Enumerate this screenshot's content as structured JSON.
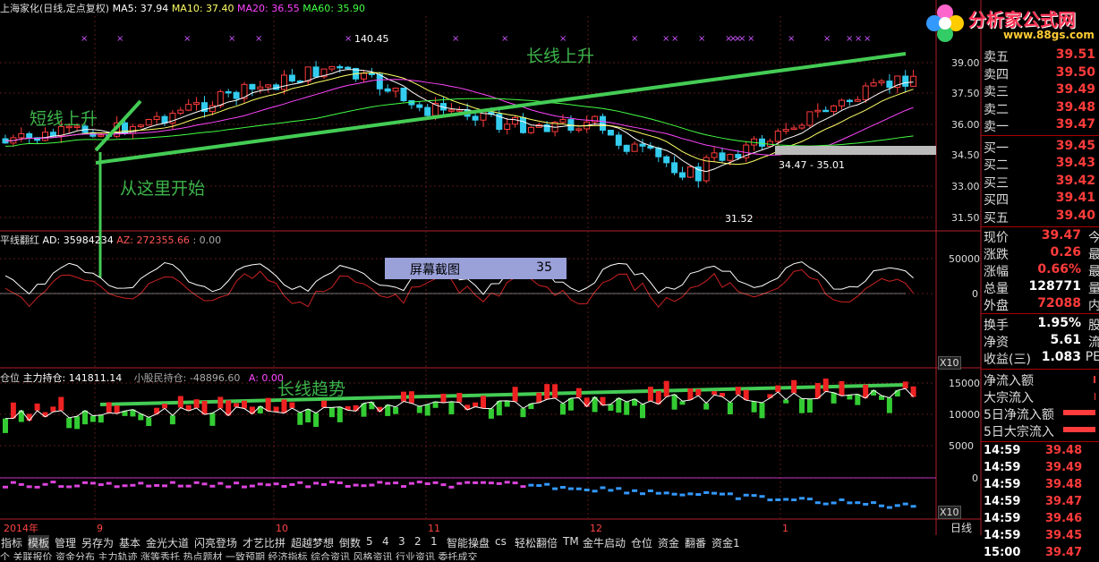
{
  "header": {
    "title": "上海家化(日线,定点复权)",
    "ma5": "MA5: 37.94",
    "ma10": "MA10: 37.40",
    "ma20": "MA20: 36.55",
    "ma60": "MA60: 35.90"
  },
  "indicator1": {
    "name": "平线翻红",
    "ad": "AD: 35984234",
    "az": "AZ: 272355.66",
    "extra": ": 0.00",
    "axis": [
      "50000",
      "0"
    ],
    "unit": "X10"
  },
  "indicator2": {
    "name": "仓位",
    "main": "主力持仓: 141811.14",
    "small": "小股民持仓: -48896.60",
    "a": "A: 0.00",
    "axis": [
      "15000",
      "10000",
      "5000",
      "0"
    ],
    "unit": "X10"
  },
  "price_axis": [
    "39.00",
    "37.50",
    "36.00",
    "34.50",
    "33.00",
    "31.50"
  ],
  "labels": {
    "high": "140.45",
    "low": "31.52",
    "range": "34.47 - 35.01"
  },
  "annotations": {
    "short_up": "短线上升",
    "start_here": "从这里开始",
    "long_up": "长线上升",
    "long_trend": "长线趋势"
  },
  "screenshot_box": {
    "label": "屏幕截图",
    "count": "35"
  },
  "time_axis": [
    "2014年",
    "9",
    "10",
    "11",
    "12",
    "1"
  ],
  "period": "日线",
  "logo": {
    "brand": "分析家公式网",
    "url": "www.88gs.com"
  },
  "order_book": [
    {
      "label": "卖五",
      "value": "39.51",
      "color": "#ff3b3b"
    },
    {
      "label": "卖四",
      "value": "39.50",
      "color": "#ff3b3b"
    },
    {
      "label": "卖三",
      "value": "39.49",
      "color": "#ff3b3b"
    },
    {
      "label": "卖二",
      "value": "39.48",
      "color": "#ff3b3b"
    },
    {
      "label": "卖一",
      "value": "39.47",
      "color": "#ff3b3b"
    },
    {
      "label": "买一",
      "value": "39.45",
      "color": "#ff3b3b"
    },
    {
      "label": "买二",
      "value": "39.43",
      "color": "#ff3b3b"
    },
    {
      "label": "买三",
      "value": "39.42",
      "color": "#ff3b3b"
    },
    {
      "label": "买四",
      "value": "39.41",
      "color": "#ff3b3b"
    },
    {
      "label": "买五",
      "value": "39.40",
      "color": "#ff3b3b"
    }
  ],
  "quote": [
    {
      "label": "现价",
      "value": "39.47",
      "extra": "今",
      "color": "#ff3b3b"
    },
    {
      "label": "涨跌",
      "value": "0.26",
      "extra": "最",
      "color": "#ff3b3b"
    },
    {
      "label": "涨幅",
      "value": "0.66%",
      "extra": "最",
      "color": "#ff3b3b"
    },
    {
      "label": "总量",
      "value": "128771",
      "extra": "量",
      "color": "#ffffff"
    },
    {
      "label": "外盘",
      "value": "72088",
      "extra": "内",
      "color": "#ff3b3b"
    },
    {
      "label": "换手",
      "value": "1.95%",
      "extra": "股",
      "color": "#ffffff"
    },
    {
      "label": "净资",
      "value": "5.61",
      "extra": "流",
      "color": "#ffffff"
    },
    {
      "label": "收益(三)",
      "value": "1.083",
      "extra": "PE",
      "color": "#ffffff"
    }
  ],
  "flows": [
    {
      "label": "净流入额"
    },
    {
      "label": "大宗流入"
    },
    {
      "label": "5日净流入额"
    },
    {
      "label": "5日大宗流入"
    }
  ],
  "ticks": [
    {
      "time": "14:59",
      "price": "39.48"
    },
    {
      "time": "14:59",
      "price": "39.49"
    },
    {
      "time": "14:59",
      "price": "39.48"
    },
    {
      "time": "14:59",
      "price": "39.47"
    },
    {
      "time": "14:59",
      "price": "39.46"
    },
    {
      "time": "14:59",
      "price": "39.45"
    },
    {
      "time": "15:00",
      "price": "39.47"
    }
  ],
  "tabs": [
    "指标",
    "模板",
    "管理",
    "另存为",
    "基本",
    "金光大道",
    "闪亮登场",
    "才艺比拼",
    "超越梦想",
    "倒数",
    "5",
    "4",
    "3",
    "2",
    "1",
    "智能操盘",
    "cs",
    "轻松翻倍",
    "TM",
    "金牛启动",
    "仓位",
    "资金",
    "翻番",
    "资金1"
  ],
  "tabs2": "个 关联报价 资金分布 主力轨迹 涨等秀托 热点题材 一致预期 经济指标 综合资讯 风格资讯 行业资讯 委托成交"
}
